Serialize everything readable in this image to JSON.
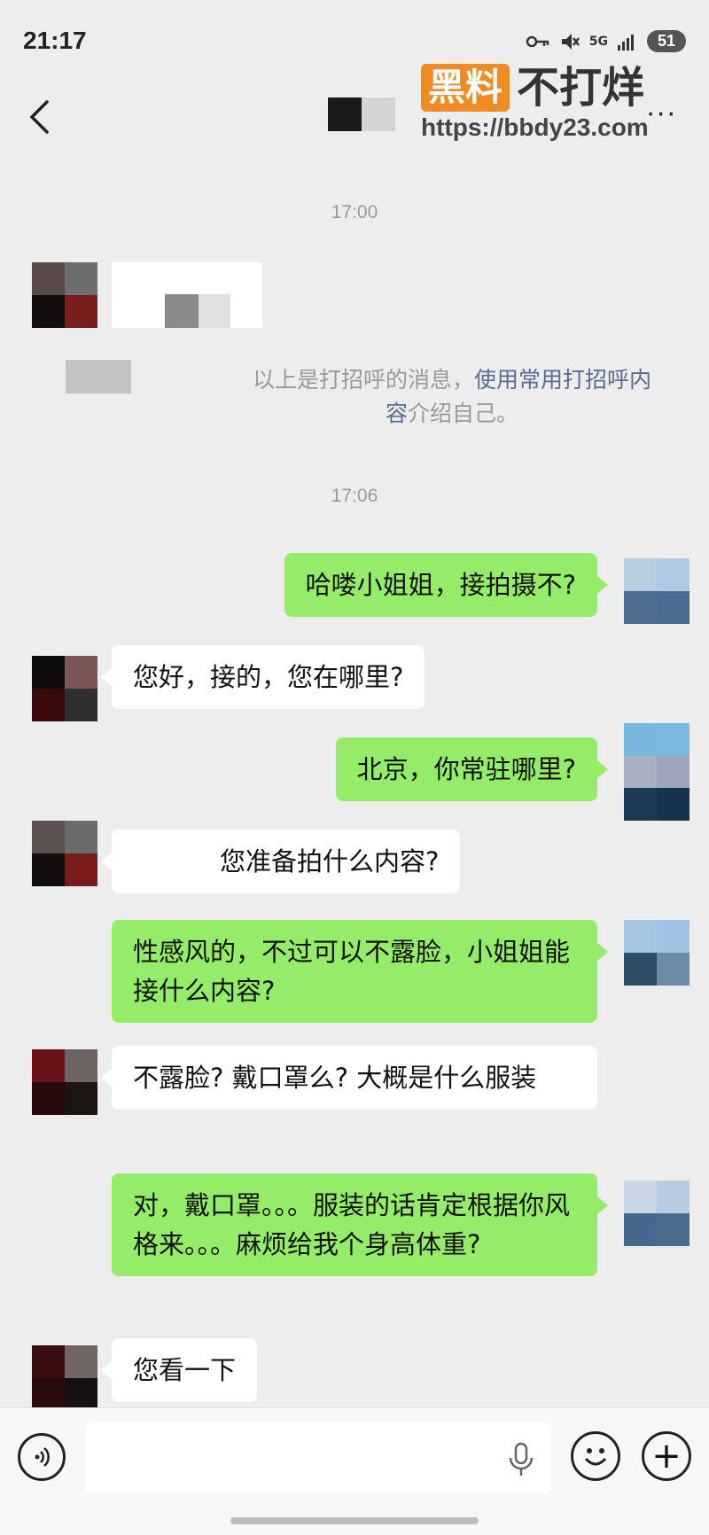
{
  "status_bar": {
    "time": "21:17",
    "network": "5G",
    "battery": "51",
    "icons": [
      "key-icon",
      "mute-icon",
      "signal-icon"
    ]
  },
  "header": {
    "back_icon": "chevron-left-icon",
    "more_icon": "more-icon",
    "more_label": "···"
  },
  "watermark": {
    "badge": "黑料",
    "brand": "不打烊",
    "url": "https://bbdy23.com",
    "badge_color": "#f08a24"
  },
  "chat": {
    "timestamps": [
      "17:00",
      "17:06"
    ],
    "system_message": {
      "prefix": "以上是打招呼的消息，",
      "link": "使用常用打招呼内容",
      "suffix": "介绍自己。"
    },
    "messages": [
      {
        "side": "out",
        "text": "哈喽小姐姐，接拍摄不?"
      },
      {
        "side": "in",
        "text": "您好，接的，您在哪里?"
      },
      {
        "side": "out",
        "text": "北京，你常驻哪里?"
      },
      {
        "side": "in",
        "text": "您准备拍什么内容?"
      },
      {
        "side": "out",
        "text": "性感风的，不过可以不露脸，小姐姐能接什么内容?"
      },
      {
        "side": "in",
        "text": "不露脸? 戴口罩么? 大概是什么服装"
      },
      {
        "side": "out",
        "text": "对，戴口罩。。。服装的话肯定根据你风格来。。。麻烦给我个身高体重?"
      },
      {
        "side": "in",
        "text": "您看一下"
      }
    ]
  },
  "input_bar": {
    "voice_icon": "voice-icon",
    "mic_icon": "microphone-icon",
    "emoji_icon": "emoji-icon",
    "plus_icon": "plus-icon",
    "plus_label": "+"
  },
  "colors": {
    "background": "#ededed",
    "outgoing_bubble": "#95ec69",
    "incoming_bubble": "#ffffff",
    "link": "#576b95"
  }
}
